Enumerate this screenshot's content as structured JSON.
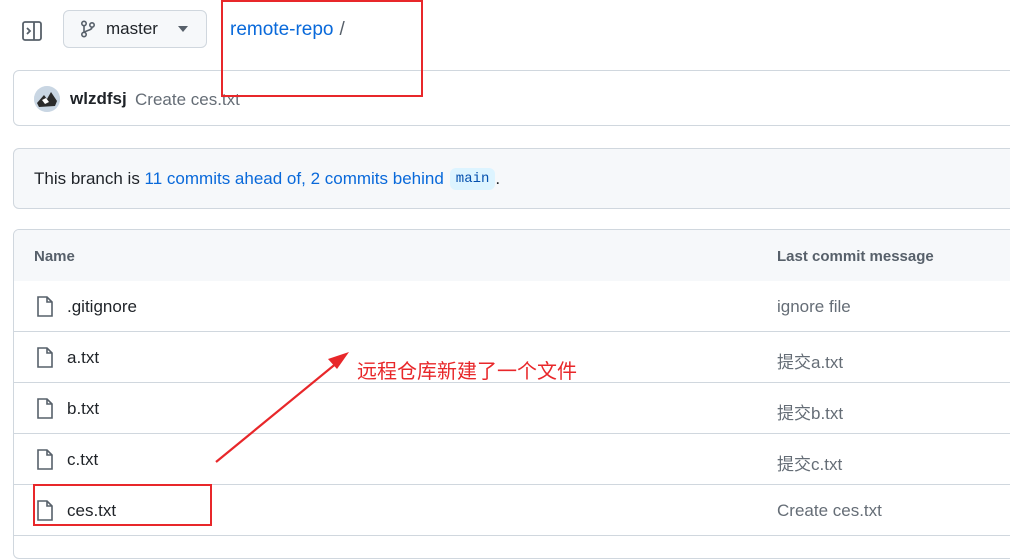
{
  "header": {
    "branch_label": "master",
    "repo_name": "remote-repo",
    "separator": "/"
  },
  "latest_commit": {
    "author": "wlzdfsj",
    "message": "Create ces.txt"
  },
  "branch_status": {
    "prefix": "This branch is ",
    "ahead_link": "11 commits ahead of,",
    "behind_link": "2 commits behind",
    "base_branch": "main",
    "suffix": "."
  },
  "file_table": {
    "columns": [
      "Name",
      "Last commit message"
    ],
    "rows": [
      {
        "name": ".gitignore",
        "message": "ignore file"
      },
      {
        "name": "a.txt",
        "message": "提交a.txt"
      },
      {
        "name": "b.txt",
        "message": "提交b.txt"
      },
      {
        "name": "c.txt",
        "message": "提交c.txt"
      },
      {
        "name": "ces.txt",
        "message": "Create ces.txt"
      }
    ]
  },
  "annotation": {
    "text": "远程仓库新建了一个文件",
    "color": "#e8272a"
  },
  "colors": {
    "link": "#0969da",
    "border": "#d0d7de",
    "muted": "#656d76",
    "annotation_red": "#e8272a"
  },
  "icons": [
    "sidebar-toggle-icon",
    "git-branch-icon",
    "caret-down-icon",
    "file-icon"
  ]
}
